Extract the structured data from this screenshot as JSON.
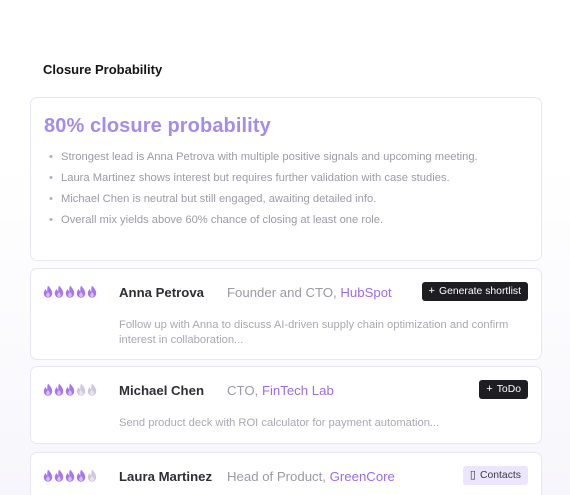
{
  "section": {
    "title": "Closure Probability"
  },
  "summary": {
    "headline": "80% closure probability",
    "bullets": [
      "Strongest lead is Anna Petrova with multiple positive signals and upcoming meeting.",
      "Laura Martinez shows interest but requires further validation with case studies.",
      "Michael Chen is neutral but still engaged, awaiting detailed info.",
      "Overall mix yields above 60% chance of closing at least one role."
    ]
  },
  "leads": [
    {
      "name": "Anna Petrova",
      "role": "Founder and CTO,",
      "company": "HubSpot",
      "heat": 5,
      "heat_max": 5,
      "note": "Follow up with Anna to discuss AI-driven supply chain optimization and confirm interest in collaboration...",
      "action": {
        "label": "Generate shortlist",
        "icon": "+",
        "icon_name": "plus-icon",
        "style": "dark"
      }
    },
    {
      "name": "Michael Chen",
      "role": "CTO,",
      "company": "FinTech Lab",
      "heat": 3,
      "heat_max": 5,
      "note": "Send product deck with ROI calculator for payment automation...",
      "action": {
        "label": "ToDo",
        "icon": "+",
        "icon_name": "plus-icon",
        "style": "dark"
      }
    },
    {
      "name": "Laura Martinez",
      "role": "Head of Product,",
      "company": "GreenCore",
      "heat": 4,
      "heat_max": 5,
      "note": "",
      "action": {
        "label": "Contacts",
        "icon": "▯",
        "icon_name": "contacts-icon",
        "style": "light"
      }
    }
  ],
  "colors": {
    "accent": "#a58cec",
    "company": "#9c6cf0",
    "flame_active": "#a974f0",
    "flame_inactive": "#cfc8dc"
  }
}
